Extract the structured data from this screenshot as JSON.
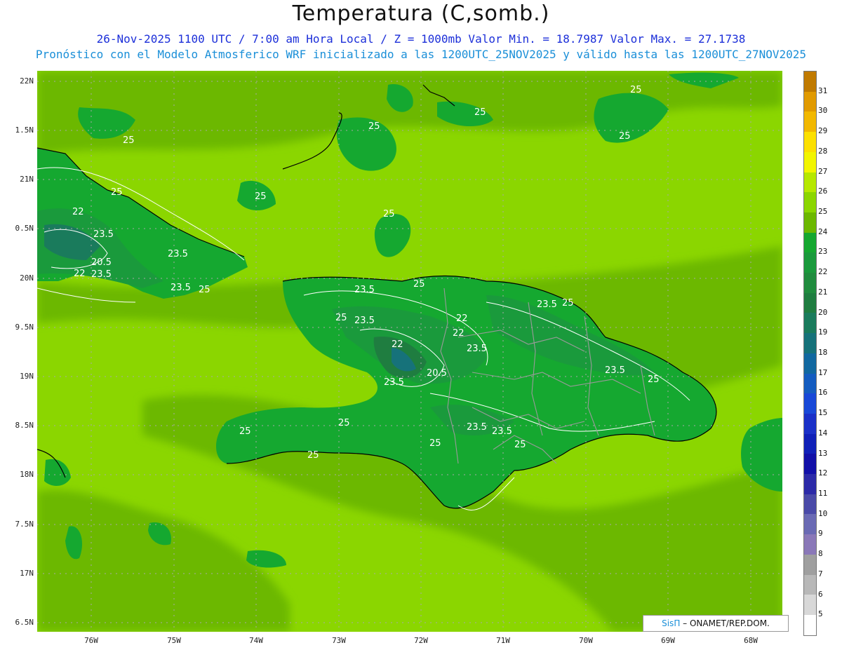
{
  "header": {
    "title": "Temperatura (C,somb.)",
    "line1": "26-Nov-2025  1100 UTC / 7:00 am Hora Local / Z = 1000mb   Valor Min. = 18.7987  Valor Max. = 27.1738",
    "line2": "Pronóstico con el Modelo Atmosferico WRF inicializado a las 1200UTC_25NOV2025 y válido hasta las  1200UTC_27NOV2025"
  },
  "axes": {
    "lat_labels": [
      "22N",
      "1.5N",
      "21N",
      "0.5N",
      "20N",
      "9.5N",
      "19N",
      "8.5N",
      "18N",
      "7.5N",
      "17N",
      "6.5N"
    ],
    "lon_labels": [
      "76W",
      "75W",
      "74W",
      "73W",
      "72W",
      "71W",
      "70W",
      "69W",
      "68W"
    ]
  },
  "colorbar": {
    "levels": [
      "31",
      "30",
      "29",
      "28",
      "27",
      "26",
      "25",
      "24",
      "23",
      "22",
      "21",
      "20",
      "19",
      "18",
      "17",
      "16",
      "15",
      "14",
      "13",
      "12",
      "11",
      "10",
      "9",
      "8",
      "7",
      "6",
      "5"
    ],
    "colors": [
      "#c07a00",
      "#e19a00",
      "#f2b800",
      "#fce000",
      "#f2f500",
      "#b6e800",
      "#8bd600",
      "#6cb800",
      "#15a830",
      "#1a9a3c",
      "#208c3e",
      "#1f7d40",
      "#1a7b5c",
      "#16727a",
      "#1168a0",
      "#145cc0",
      "#1848d8",
      "#1a30c8",
      "#1020b8",
      "#1210a8",
      "#2c2aa8",
      "#4a4aa8",
      "#6a6ab4",
      "#8a78b8",
      "#9f9f9f",
      "#b8b8b8",
      "#d8d8d8",
      "#ffffff"
    ]
  },
  "contour_labels": [
    "25",
    "25",
    "25",
    "25",
    "25",
    "25",
    "22",
    "23.5",
    "23.5",
    "20.5",
    "22",
    "23.5",
    "25",
    "25",
    "23.5",
    "25",
    "25",
    "23.5",
    "25",
    "23.5",
    "22",
    "22",
    "22",
    "23.5",
    "20.5",
    "23.5",
    "23.5",
    "25",
    "25",
    "23.5",
    "25",
    "23.5",
    "25",
    "25",
    "23.5",
    "25",
    "25"
  ],
  "credit": {
    "brand": "SisΠ",
    "text": " – ONAMET/REP.DOM."
  }
}
